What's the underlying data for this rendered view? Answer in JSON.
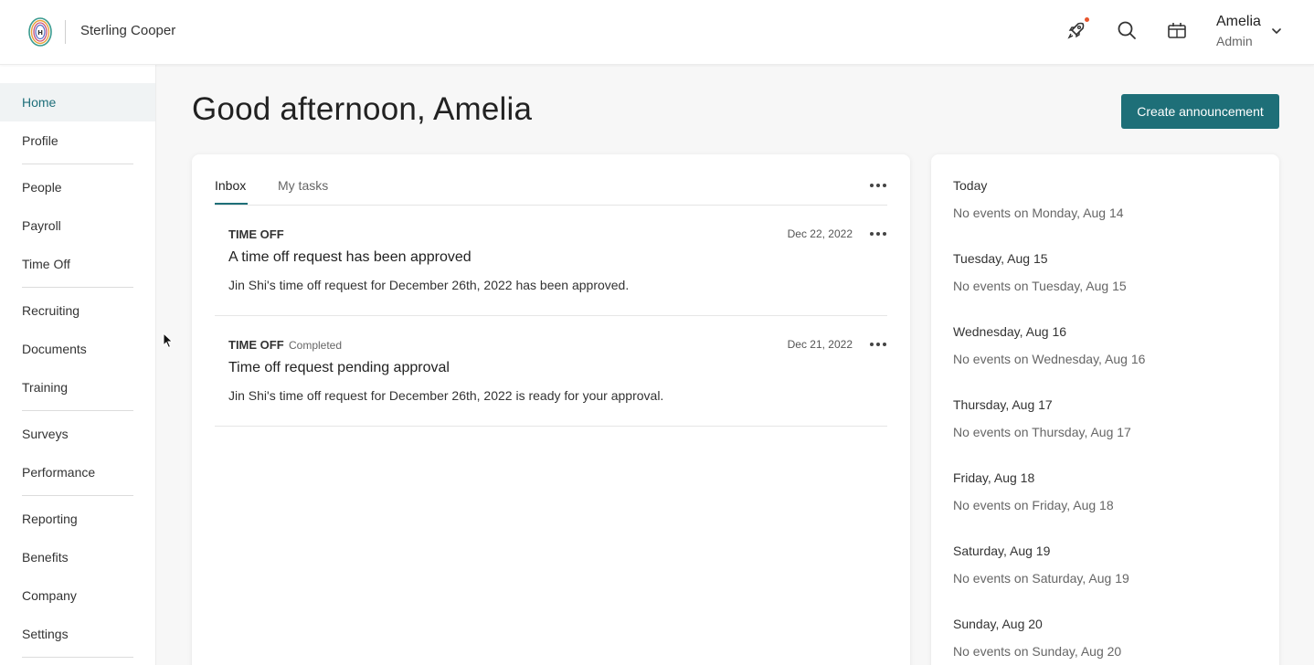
{
  "header": {
    "company_name": "Sterling Cooper",
    "user": {
      "name": "Amelia",
      "role": "Admin"
    },
    "icons": [
      "rocket-icon",
      "search-icon",
      "calendar-gift-icon",
      "chevron-down-icon"
    ],
    "accent_color": "#1e6f78",
    "notification_color": "#e8552d"
  },
  "sidebar": {
    "items": [
      {
        "label": "Home",
        "active": true
      },
      {
        "label": "Profile"
      },
      {
        "label": "People"
      },
      {
        "label": "Payroll"
      },
      {
        "label": "Time Off"
      },
      {
        "label": "Recruiting"
      },
      {
        "label": "Documents"
      },
      {
        "label": "Training"
      },
      {
        "label": "Surveys"
      },
      {
        "label": "Performance"
      },
      {
        "label": "Reporting"
      },
      {
        "label": "Benefits"
      },
      {
        "label": "Company"
      },
      {
        "label": "Settings"
      }
    ]
  },
  "main": {
    "greeting": "Good afternoon, Amelia",
    "create_button": "Create announcement",
    "tabs": [
      {
        "label": "Inbox",
        "active": true
      },
      {
        "label": "My tasks"
      }
    ],
    "inbox": [
      {
        "category": "TIME OFF",
        "badge": "",
        "date": "Dec 22, 2022",
        "title": "A time off request has been approved",
        "body": "Jin Shi's time off request for December 26th, 2022 has been approved."
      },
      {
        "category": "TIME OFF",
        "badge": "Completed",
        "date": "Dec 21, 2022",
        "title": "Time off request pending approval",
        "body": "Jin Shi's time off request for December 26th, 2022 is ready for your approval."
      }
    ]
  },
  "calendar": {
    "days": [
      {
        "label": "Today",
        "empty": "No events on Monday, Aug 14"
      },
      {
        "label": "Tuesday, Aug 15",
        "empty": "No events on Tuesday, Aug 15"
      },
      {
        "label": "Wednesday, Aug 16",
        "empty": "No events on Wednesday, Aug 16"
      },
      {
        "label": "Thursday, Aug 17",
        "empty": "No events on Thursday, Aug 17"
      },
      {
        "label": "Friday, Aug 18",
        "empty": "No events on Friday, Aug 18"
      },
      {
        "label": "Saturday, Aug 19",
        "empty": "No events on Saturday, Aug 19"
      },
      {
        "label": "Sunday, Aug 20",
        "empty": "No events on Sunday, Aug 20"
      }
    ]
  }
}
